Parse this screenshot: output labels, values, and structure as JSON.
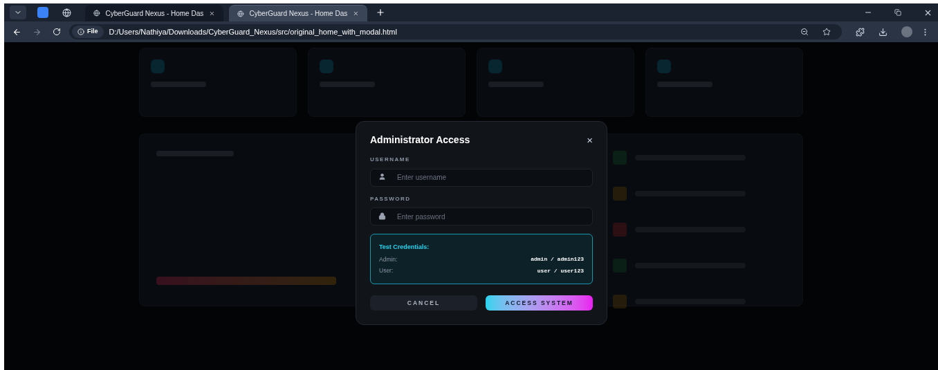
{
  "browser": {
    "tabs": [
      {
        "title": "CyberGuard Nexus - Home Das",
        "selected": false
      },
      {
        "title": "CyberGuard Nexus - Home Das",
        "selected": true
      }
    ],
    "address": {
      "scheme": "File",
      "url": "D:/Users/Nathiya/Downloads/CyberGuard_Nexus/src/original_home_with_modal.html"
    }
  },
  "modal": {
    "title": "Administrator Access",
    "close": "×",
    "fields": [
      {
        "label": "USERNAME",
        "placeholder": "Enter username",
        "kind": "user"
      },
      {
        "label": "PASSWORD",
        "placeholder": "Enter password",
        "kind": "lock"
      }
    ],
    "credentials": {
      "title": "Test Credentials:",
      "rows": [
        {
          "label": "Admin:",
          "value": "admin / admin123"
        },
        {
          "label": "User:",
          "value": "user / user123"
        }
      ]
    },
    "buttons": [
      {
        "label": "CANCEL",
        "kind": "secondary"
      },
      {
        "label": "ACCESS SYSTEM",
        "kind": "primary"
      }
    ]
  }
}
